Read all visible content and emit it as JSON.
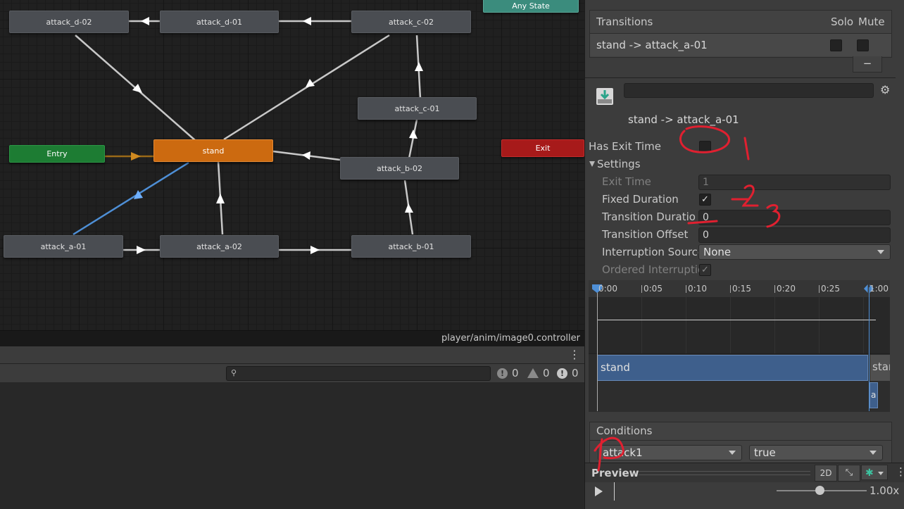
{
  "graph": {
    "nodes": {
      "any_state": "Any State",
      "attack_d_02": "attack_d-02",
      "attack_d_01": "attack_d-01",
      "attack_c_02": "attack_c-02",
      "attack_c_01": "attack_c-01",
      "entry": "Entry",
      "stand": "stand",
      "exit": "Exit",
      "attack_b_02": "attack_b-02",
      "attack_a_01": "attack_a-01",
      "attack_a_02": "attack_a-02",
      "attack_b_01": "attack_b-01"
    },
    "path": "player/anim/image0.controller"
  },
  "console": {
    "search_placeholder": "",
    "info_count": "0",
    "warning_count": "0",
    "error_count": "0"
  },
  "inspector": {
    "transitions_header": "Transitions",
    "solo_label": "Solo",
    "mute_label": "Mute",
    "transition_item": "stand -> attack_a-01",
    "minus_label": "−",
    "name_field": "",
    "title": "stand -> attack_a-01",
    "has_exit_time_label": "Has Exit Time",
    "settings_label": "Settings",
    "exit_time_label": "Exit Time",
    "exit_time_value": "1",
    "fixed_duration_label": "Fixed Duration",
    "transition_duration_label": "Transition Duratio",
    "transition_duration_value": "0",
    "transition_offset_label": "Transition Offset",
    "transition_offset_value": "0",
    "interruption_source_label": "Interruption Source",
    "interruption_source_value": "None",
    "ordered_interruption_label": "Ordered Interruptio",
    "timeline_ticks": [
      "0:00",
      "0:05",
      "0:10",
      "0:15",
      "0:20",
      "0:25",
      "1:00"
    ],
    "track_source": "stand",
    "track_source_next": "star",
    "track_dest": "a",
    "conditions_label": "Conditions",
    "condition_param": "attack1",
    "condition_value": "true",
    "preview_label": "Preview",
    "btn_2d": "2D",
    "speed": "1.00x"
  },
  "annotations": [
    "1",
    "2",
    "3",
    "4"
  ],
  "colors": {
    "default_state": "#cc6a10",
    "entry": "#1d7c33",
    "exit": "#a71a1a",
    "any_state": "#3b8c7d",
    "selected_transition": "#4e8fd6",
    "annotation_red": "#e02030"
  }
}
